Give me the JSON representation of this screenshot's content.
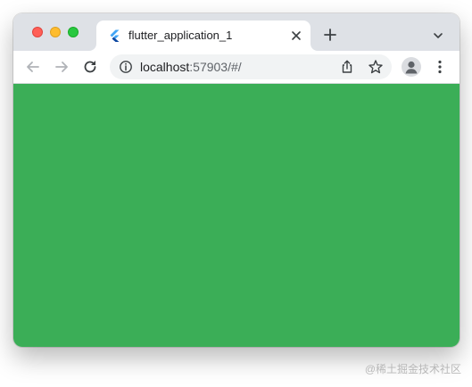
{
  "window": {
    "traffic_lights": {
      "close_color": "#ff5f57",
      "minimize_color": "#febc2e",
      "maximize_color": "#28c840"
    }
  },
  "tabs": [
    {
      "title": "flutter_application_1",
      "favicon": "flutter-icon",
      "active": true
    }
  ],
  "tabstrip": {
    "new_tab_icon": "plus-icon",
    "tab_search_icon": "chevron-down-icon"
  },
  "toolbar": {
    "back_icon": "arrow-left-icon",
    "forward_icon": "arrow-right-icon",
    "reload_icon": "reload-icon",
    "address": {
      "host": "localhost",
      "rest": ":57903/#/",
      "info_icon": "info-icon",
      "share_icon": "share-icon",
      "bookmark_icon": "star-icon"
    },
    "profile_icon": "profile-avatar-icon",
    "menu_icon": "more-vertical-icon"
  },
  "page": {
    "background_color": "#3bae57"
  },
  "watermark": {
    "text": "@稀土掘金技术社区"
  }
}
